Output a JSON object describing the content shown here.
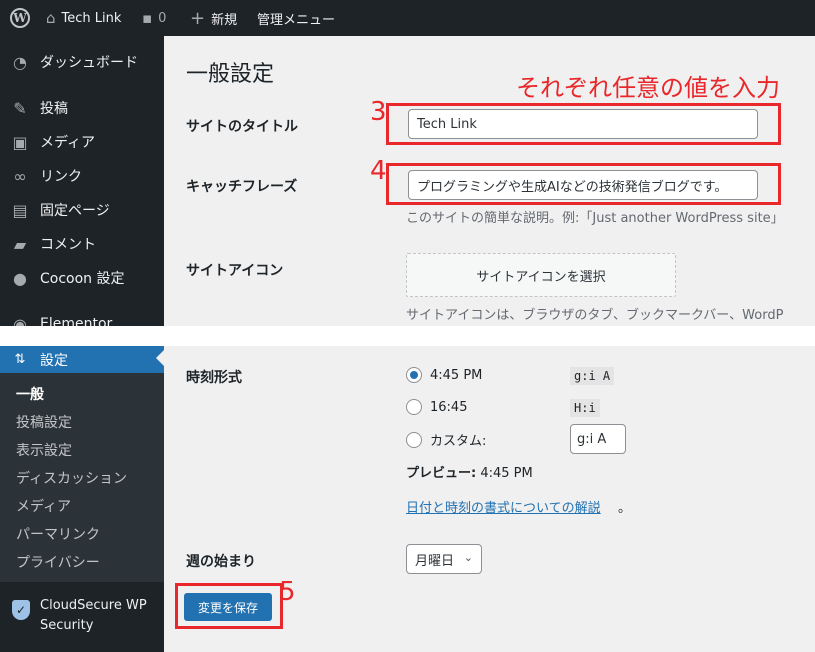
{
  "adminbar": {
    "site_name": "Tech Link",
    "comments_count": "0",
    "new_label": "新規",
    "admin_menu_label": "管理メニュー"
  },
  "sidebar_top": {
    "items": [
      {
        "label": "ダッシュボード",
        "icon": "dashboard-icon"
      },
      {
        "label": "投稿",
        "icon": "pin-icon"
      },
      {
        "label": "メディア",
        "icon": "media-icon"
      },
      {
        "label": "リンク",
        "icon": "link-icon"
      },
      {
        "label": "固定ページ",
        "icon": "page-icon"
      },
      {
        "label": "コメント",
        "icon": "comment-icon"
      },
      {
        "label": "Cocoon 設定",
        "icon": "cocoon-icon"
      },
      {
        "label": "Elementor",
        "icon": "elementor-icon"
      }
    ]
  },
  "general": {
    "page_title": "一般設定",
    "annotation_note": "それぞれ任意の値を入力",
    "site_title_label": "サイトのタイトル",
    "site_title_value": "Tech Link",
    "tagline_label": "キャッチフレーズ",
    "tagline_value": "プログラミングや生成AIなどの技術発信ブログです。",
    "tagline_desc": "このサイトの簡単な説明。例:「Just another WordPress site」",
    "site_icon_label": "サイトアイコン",
    "site_icon_button": "サイトアイコンを選択",
    "site_icon_desc": "サイトアイコンは、ブラウザのタブ、ブックマークバー、WordP"
  },
  "annotations": {
    "step3": "3",
    "step4": "4",
    "step5": "5",
    "color": "#e8282a"
  },
  "sidebar_bottom": {
    "current_menu": "設定",
    "submenu": [
      "一般",
      "投稿設定",
      "表示設定",
      "ディスカッション",
      "メディア",
      "パーマリンク",
      "プライバシー"
    ],
    "cloudsecure_label": "CloudSecure WP Security"
  },
  "time_format": {
    "label": "時刻形式",
    "options": [
      {
        "label": "4:45 PM",
        "code": "g:i A",
        "checked": true
      },
      {
        "label": "16:45",
        "code": "H:i",
        "checked": false
      },
      {
        "label": "カスタム:",
        "code": "",
        "checked": false
      }
    ],
    "custom_value": "g:i A",
    "preview_label": "プレビュー:",
    "preview_value": "4:45 PM",
    "doc_link": "日付と時刻の書式についての解説"
  },
  "week_start": {
    "label": "週の始まり",
    "selected": "月曜日"
  },
  "save_button": "変更を保存",
  "colors": {
    "admin_dark": "#1d2327",
    "wp_blue": "#2271b1",
    "background": "#f0f0f1"
  }
}
